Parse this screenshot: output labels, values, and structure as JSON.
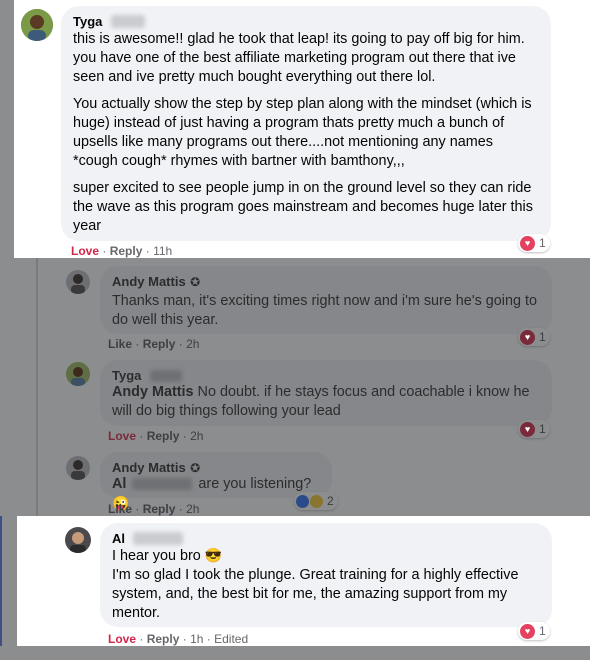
{
  "comments": [
    {
      "author": "Tyga",
      "paragraphs": [
        "this is awesome!! glad he took that leap! its going to pay off big for him. you have one of the best affiliate marketing program out there that ive seen and ive pretty much bought everything out there lol.",
        "You actually show the step by step plan along with the mindset (which is huge) instead of just having a program thats pretty much a bunch of upsells like many programs out there....not mentioning any names *cough cough* rhymes with bartner with bamthony,,,",
        "super excited to see people jump in on the ground level so they can ride the wave as this program goes mainstream and becomes huge later this year"
      ],
      "action_react": "Love",
      "action_reply": "Reply",
      "time": "11h",
      "reaction_count": "1"
    },
    {
      "author": "Andy Mattis",
      "text": "Thanks man, it's exciting times right now and i'm sure he's going to do well this year.",
      "action_react": "Like",
      "action_reply": "Reply",
      "time": "2h",
      "reaction_count": "1"
    },
    {
      "author": "Tyga",
      "mention": "Andy Mattis",
      "text": " No doubt. if he stays focus and coachable i know he will do big things following your lead",
      "action_react": "Love",
      "action_reply": "Reply",
      "time": "2h",
      "reaction_count": "1"
    },
    {
      "author": "Andy Mattis",
      "mention": "Al",
      "text": "are you listening?",
      "emoji": "😜",
      "action_react": "Like",
      "action_reply": "Reply",
      "time": "2h",
      "reaction_count": "2"
    },
    {
      "author": "Al",
      "line1": "I hear you bro",
      "line1_emoji": "😎",
      "text": "I'm so glad I took the plunge. Great training for a highly effective system, and, the best bit for me, the amazing support from my mentor.",
      "action_react": "Love",
      "action_reply": "Reply",
      "time": "1h",
      "edited": "Edited",
      "reaction_count": "1"
    }
  ],
  "colors": {
    "love": "#d2254a",
    "bubble": "#f0f2f5",
    "dim_background": "#8c8d8f"
  }
}
